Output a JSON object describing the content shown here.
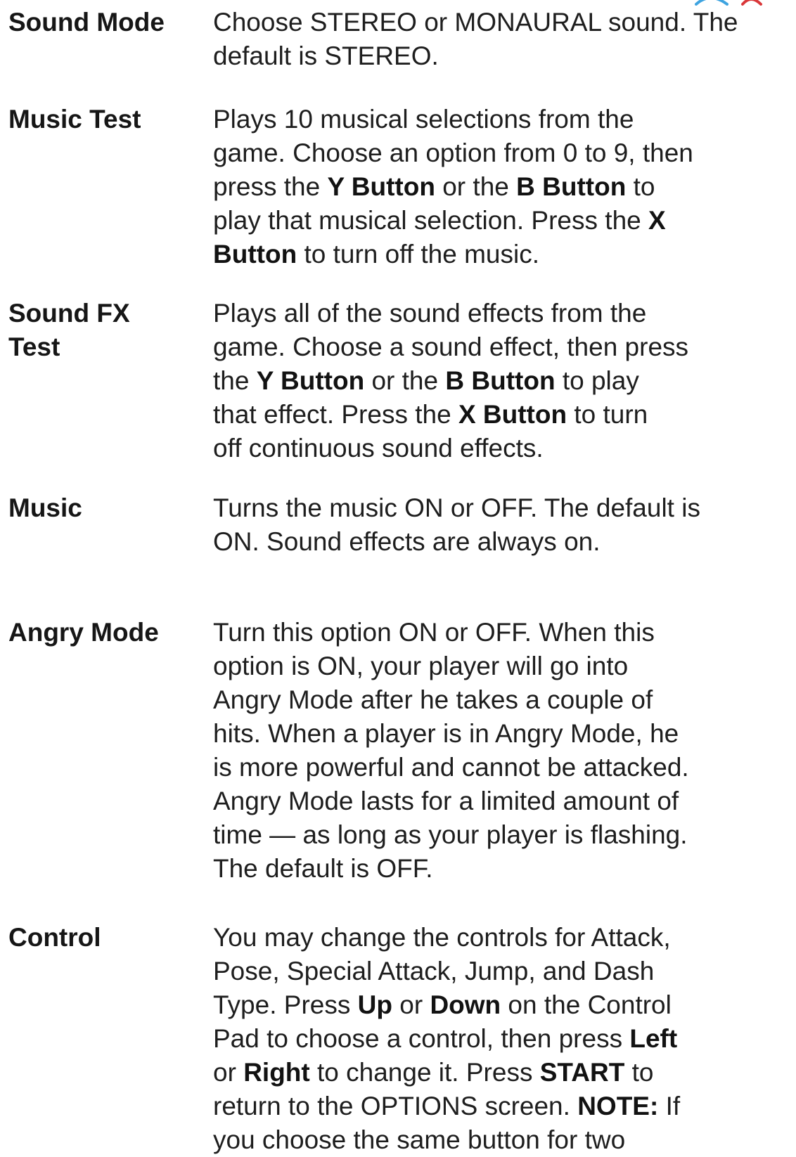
{
  "entries": [
    {
      "term": [
        "Sound Mode"
      ],
      "lines": [
        [
          {
            "t": "Choose STEREO or MONAURAL sound.  The"
          }
        ],
        [
          {
            "t": "default is STEREO."
          }
        ]
      ]
    },
    {
      "term": [
        "Music Test"
      ],
      "lines": [
        [
          {
            "t": "Plays 10 musical selections from the"
          }
        ],
        [
          {
            "t": "game.  Choose an option from 0 to 9, then"
          }
        ],
        [
          {
            "t": "press the "
          },
          {
            "t": "Y Button",
            "b": true
          },
          {
            "t": " or the "
          },
          {
            "t": "B Button",
            "b": true
          },
          {
            "t": " to"
          }
        ],
        [
          {
            "t": "play that musical selection.  Press the "
          },
          {
            "t": "X",
            "b": true
          }
        ],
        [
          {
            "t": "Button",
            "b": true
          },
          {
            "t": " to turn off the music."
          }
        ]
      ]
    },
    {
      "term": [
        "Sound FX",
        "Test"
      ],
      "lines": [
        [
          {
            "t": "Plays all of the sound effects from the"
          }
        ],
        [
          {
            "t": "game.  Choose a sound effect, then press"
          }
        ],
        [
          {
            "t": "the "
          },
          {
            "t": "Y Button",
            "b": true
          },
          {
            "t": " or the "
          },
          {
            "t": "B Button",
            "b": true
          },
          {
            "t": " to play"
          }
        ],
        [
          {
            "t": "that effect.  Press the "
          },
          {
            "t": "X Button",
            "b": true
          },
          {
            "t": " to turn"
          }
        ],
        [
          {
            "t": "off continuous sound effects."
          }
        ]
      ]
    },
    {
      "term": [
        "Music"
      ],
      "lines": [
        [
          {
            "t": "Turns the music ON or OFF.  The default is"
          }
        ],
        [
          {
            "t": "ON.  Sound effects are always on."
          }
        ]
      ]
    },
    {
      "term": [
        "Angry Mode"
      ],
      "lines": [
        [
          {
            "t": "Turn this option ON or OFF.  When this"
          }
        ],
        [
          {
            "t": "option is ON, your player will go into"
          }
        ],
        [
          {
            "t": "Angry Mode after he takes a couple of"
          }
        ],
        [
          {
            "t": "hits.  When a player is in Angry Mode, he"
          }
        ],
        [
          {
            "t": "is more powerful and cannot be attacked."
          }
        ],
        [
          {
            "t": "Angry Mode lasts for a limited amount of"
          }
        ],
        [
          {
            "t": "time — as long as your player is flashing."
          }
        ],
        [
          {
            "t": "The default is OFF."
          }
        ]
      ]
    },
    {
      "term": [
        "Control"
      ],
      "lines": [
        [
          {
            "t": "You may change the controls for Attack,"
          }
        ],
        [
          {
            "t": "Pose, Special Attack, Jump, and Dash"
          }
        ],
        [
          {
            "t": "Type.  Press "
          },
          {
            "t": "Up",
            "b": true
          },
          {
            "t": " or "
          },
          {
            "t": "Down",
            "b": true
          },
          {
            "t": " on the Control"
          }
        ],
        [
          {
            "t": "Pad to choose a control, then press "
          },
          {
            "t": "Left",
            "b": true
          }
        ],
        [
          {
            "t": "or "
          },
          {
            "t": "Right",
            "b": true
          },
          {
            "t": " to change it.  Press "
          },
          {
            "t": "START",
            "b": true
          },
          {
            "t": " to"
          }
        ],
        [
          {
            "t": "return to the OPTIONS screen.  "
          },
          {
            "t": "NOTE:",
            "b": true
          },
          {
            "t": "  If"
          }
        ],
        [
          {
            "t": "you choose the same button for two"
          }
        ]
      ]
    }
  ],
  "colors": {
    "text": "#1e1e1e",
    "background": "#ffffff",
    "corner_art_blue": "#3fa4e0",
    "corner_art_red": "#d9383a"
  },
  "icons": {
    "corner_art": "decorative-artwork-fragment"
  }
}
